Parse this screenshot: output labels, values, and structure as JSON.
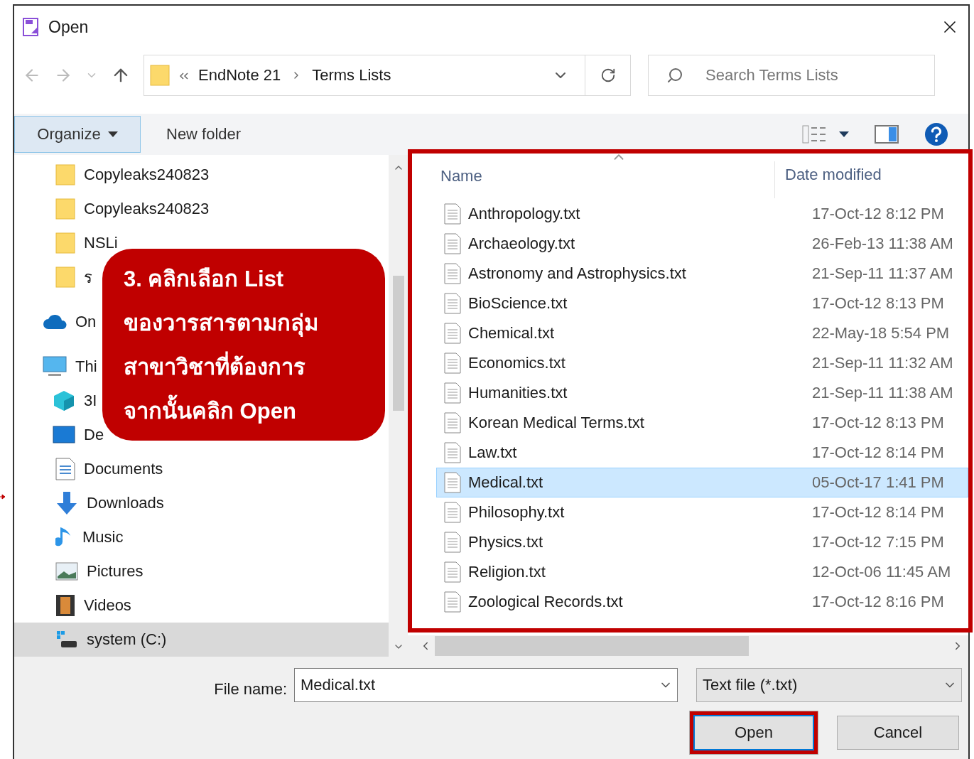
{
  "window": {
    "title": "Open"
  },
  "nav": {
    "breadcrumb": [
      "EndNote 21",
      "Terms Lists"
    ],
    "search": {
      "placeholder": "Search Terms Lists"
    }
  },
  "toolbar": {
    "organize": "Organize",
    "new_folder": "New folder"
  },
  "sidebar": {
    "items": [
      {
        "label": "Copyleaks240823",
        "kind": "folder",
        "selected": false
      },
      {
        "label": "Copyleaks240823",
        "kind": "folder",
        "selected": false
      },
      {
        "label": "NSLi",
        "kind": "folder",
        "selected": false
      },
      {
        "label": "ร",
        "kind": "folder",
        "selected": false
      },
      {
        "label": "On",
        "kind": "cloud",
        "selected": false
      },
      {
        "label": "Thi",
        "kind": "pc",
        "selected": false
      },
      {
        "label": "3I",
        "kind": "cube",
        "selected": false
      },
      {
        "label": "De",
        "kind": "desktop",
        "selected": false
      },
      {
        "label": "Documents",
        "kind": "documents",
        "selected": false
      },
      {
        "label": "Downloads",
        "kind": "downloads",
        "selected": false
      },
      {
        "label": "Music",
        "kind": "music",
        "selected": false
      },
      {
        "label": "Pictures",
        "kind": "pictures",
        "selected": false
      },
      {
        "label": "Videos",
        "kind": "videos",
        "selected": false
      },
      {
        "label": "system (C:)",
        "kind": "drive",
        "selected": true
      }
    ]
  },
  "file_list": {
    "highlighted": true,
    "columns": [
      "Name",
      "Date modified"
    ],
    "rows": [
      {
        "name": "Anthropology.txt",
        "date": "17-Oct-12 8:12 PM",
        "selected": false
      },
      {
        "name": "Archaeology.txt",
        "date": "26-Feb-13 11:38 AM",
        "selected": false
      },
      {
        "name": "Astronomy and Astrophysics.txt",
        "date": "21-Sep-11 11:37 AM",
        "selected": false
      },
      {
        "name": "BioScience.txt",
        "date": "17-Oct-12 8:13 PM",
        "selected": false
      },
      {
        "name": "Chemical.txt",
        "date": "22-May-18 5:54 PM",
        "selected": false
      },
      {
        "name": "Economics.txt",
        "date": "21-Sep-11 11:32 AM",
        "selected": false
      },
      {
        "name": "Humanities.txt",
        "date": "21-Sep-11 11:38 AM",
        "selected": false
      },
      {
        "name": "Korean Medical Terms.txt",
        "date": "17-Oct-12 8:13 PM",
        "selected": false
      },
      {
        "name": "Law.txt",
        "date": "17-Oct-12 8:14 PM",
        "selected": false
      },
      {
        "name": "Medical.txt",
        "date": "05-Oct-17 1:41 PM",
        "selected": true
      },
      {
        "name": "Philosophy.txt",
        "date": "17-Oct-12 8:14 PM",
        "selected": false
      },
      {
        "name": "Physics.txt",
        "date": "17-Oct-12 7:15 PM",
        "selected": false
      },
      {
        "name": "Religion.txt",
        "date": "12-Oct-06 11:45 AM",
        "selected": false
      },
      {
        "name": "Zoological Records.txt",
        "date": "17-Oct-12 8:16 PM",
        "selected": false
      }
    ]
  },
  "footer": {
    "file_name_label": "File name:",
    "file_name": "Medical.txt",
    "file_type": "Text file  (*.txt)",
    "buttons": [
      {
        "label": "Open",
        "highlighted": true
      },
      {
        "label": "Cancel",
        "highlighted": false
      }
    ]
  },
  "callout": {
    "lines": [
      "3. คลิกเลือก List",
      "ของวารสารตามกลุ่ม",
      "สาขาวิชาที่ต้องการ",
      "จากนั้นคลิก Open"
    ]
  }
}
